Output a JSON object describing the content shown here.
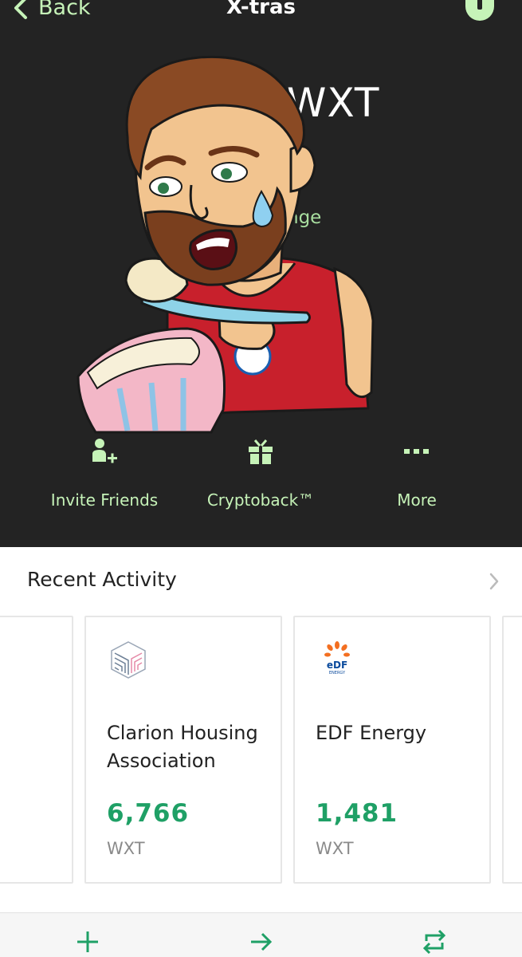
{
  "nav": {
    "back_label": "Back",
    "title": "X-tras"
  },
  "token": {
    "symbol": "WXT",
    "sub_text": "nge"
  },
  "actions": [
    {
      "label": "Invite Friends",
      "icon": "add-user-icon"
    },
    {
      "label": "Cryptoback™",
      "icon": "gift-icon"
    },
    {
      "label": "More",
      "icon": "more-dots-icon"
    }
  ],
  "recent": {
    "title": "Recent Activity",
    "cards": [
      {
        "merchant": "Clarion Housing Association",
        "amount": "6,766",
        "unit": "WXT",
        "logo": "clarion-cube-logo"
      },
      {
        "merchant": "EDF Energy",
        "amount": "1,481",
        "unit": "WXT",
        "logo": "edf-energy-logo",
        "logo_text": "eDF",
        "logo_subtext": "ENERGY"
      }
    ]
  },
  "bottom_bar": {
    "buttons": [
      "add-icon",
      "send-arrow-icon",
      "swap-icon"
    ]
  },
  "colors": {
    "dark_bg": "#232323",
    "accent_light_green": "#c6f3b8",
    "amount_green": "#1fa066",
    "edf_orange": "#f36f21",
    "edf_blue": "#0a4a9c"
  }
}
